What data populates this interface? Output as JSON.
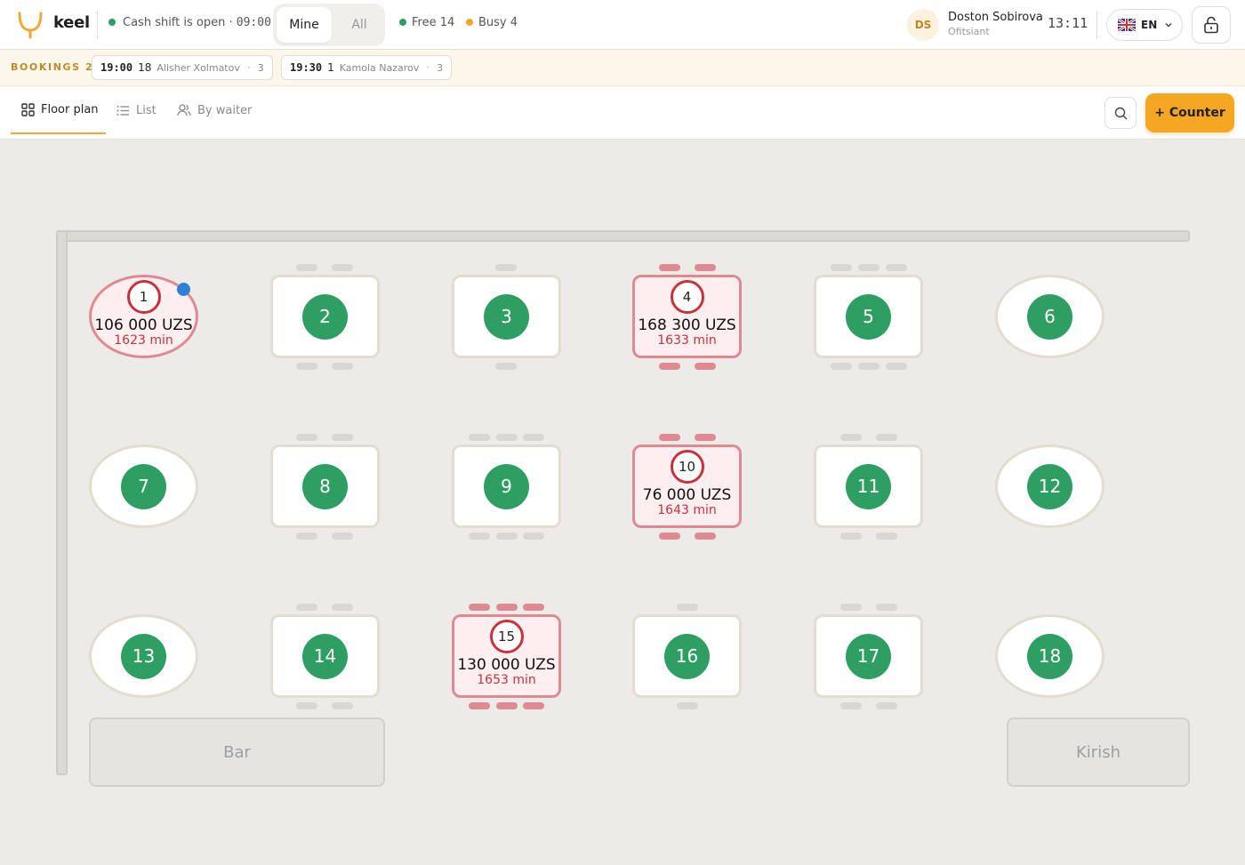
{
  "app": {
    "name": "keel",
    "brand_color": "#f5a623"
  },
  "header": {
    "shift_status": "Cash shift is open ·",
    "shift_time": "09:00",
    "filter": {
      "options": [
        "Mine",
        "All"
      ],
      "selected": "Mine"
    },
    "free_label": "Free 14",
    "busy_label": "Busy 4",
    "user": {
      "initials": "DS",
      "name": "Doston Sobirova",
      "role": "Ofitsiant"
    },
    "clock": "13:11",
    "language": "EN"
  },
  "bookings": {
    "label": "BOOKINGS 2",
    "items": [
      {
        "time": "19:00",
        "table": "18",
        "guest": "Alisher Xolmatov",
        "people": "3"
      },
      {
        "time": "19:30",
        "table": "1",
        "guest": "Kamola Nazarov",
        "people": "3"
      }
    ]
  },
  "tabs": [
    {
      "label": "Floor plan",
      "active": true,
      "icon": "grid-icon"
    },
    {
      "label": "List",
      "active": false,
      "icon": "list-icon"
    },
    {
      "label": "By waiter",
      "active": false,
      "icon": "users-icon"
    }
  ],
  "actions": {
    "counter_label": "+ Counter"
  },
  "floor": {
    "tables": [
      {
        "number": "1",
        "status": "busy",
        "amount": "106 000 UZS",
        "minutes": "1623 min"
      },
      {
        "number": "2",
        "status": "free"
      },
      {
        "number": "3",
        "status": "free"
      },
      {
        "number": "4",
        "status": "busy",
        "amount": "168 300 UZS",
        "minutes": "1633 min"
      },
      {
        "number": "5",
        "status": "free"
      },
      {
        "number": "6",
        "status": "free"
      },
      {
        "number": "7",
        "status": "free"
      },
      {
        "number": "8",
        "status": "free"
      },
      {
        "number": "9",
        "status": "free"
      },
      {
        "number": "10",
        "status": "busy",
        "amount": "76 000 UZS",
        "minutes": "1643 min"
      },
      {
        "number": "11",
        "status": "free"
      },
      {
        "number": "12",
        "status": "free"
      },
      {
        "number": "13",
        "status": "free"
      },
      {
        "number": "14",
        "status": "free"
      },
      {
        "number": "15",
        "status": "busy",
        "amount": "130 000 UZS",
        "minutes": "1653 min"
      },
      {
        "number": "16",
        "status": "free"
      },
      {
        "number": "17",
        "status": "free"
      },
      {
        "number": "18",
        "status": "free"
      }
    ],
    "zones": {
      "bar": "Bar",
      "kirish": "Kirish"
    }
  },
  "colors": {
    "free": "#2e9e63",
    "busy": "#c8323c",
    "selected_marker": "#2f7fd8"
  }
}
